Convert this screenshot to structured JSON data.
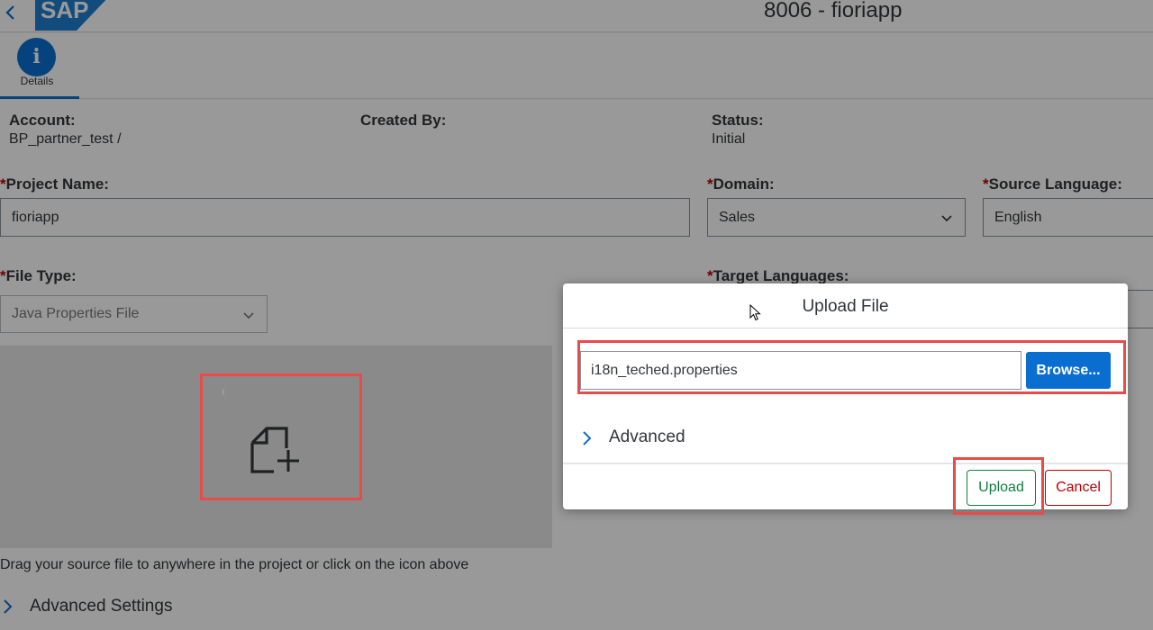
{
  "header": {
    "back_icon": "chevron-left-icon",
    "logo_text": "SAP",
    "title": "8006 - fioriapp"
  },
  "tabs": [
    {
      "icon": "info-icon",
      "icon_glyph": "i",
      "label": "Details",
      "selected": true
    }
  ],
  "info": {
    "account_label": "Account:",
    "account_value": "BP_partner_test /",
    "created_by_label": "Created By:",
    "status_label": "Status:",
    "status_value": "Initial"
  },
  "form": {
    "required_marker": "*",
    "project_name_label": "Project Name:",
    "project_name_value": "fioriapp",
    "domain_label": "Domain:",
    "domain_value": "Sales",
    "source_language_label": "Source Language:",
    "source_language_value": "English",
    "file_type_label": "File Type:",
    "file_type_value": "Java Properties File",
    "target_languages_label": "Target Languages:"
  },
  "dropzone": {
    "icon": "file-add-icon",
    "hint": "Drag your source file to anywhere in the project or click on the icon above"
  },
  "advanced_settings": {
    "label": "Advanced Settings",
    "icon": "chevron-right-icon"
  },
  "dialog": {
    "title": "Upload File",
    "file_input_value": "i18n_teched.properties",
    "browse_label": "Browse...",
    "advanced_label": "Advanced",
    "upload_label": "Upload",
    "cancel_label": "Cancel"
  },
  "colors": {
    "accent": "#0a6ed1",
    "accept": "#107e3e",
    "reject": "#bb0000",
    "highlight": "#e94a4a"
  }
}
